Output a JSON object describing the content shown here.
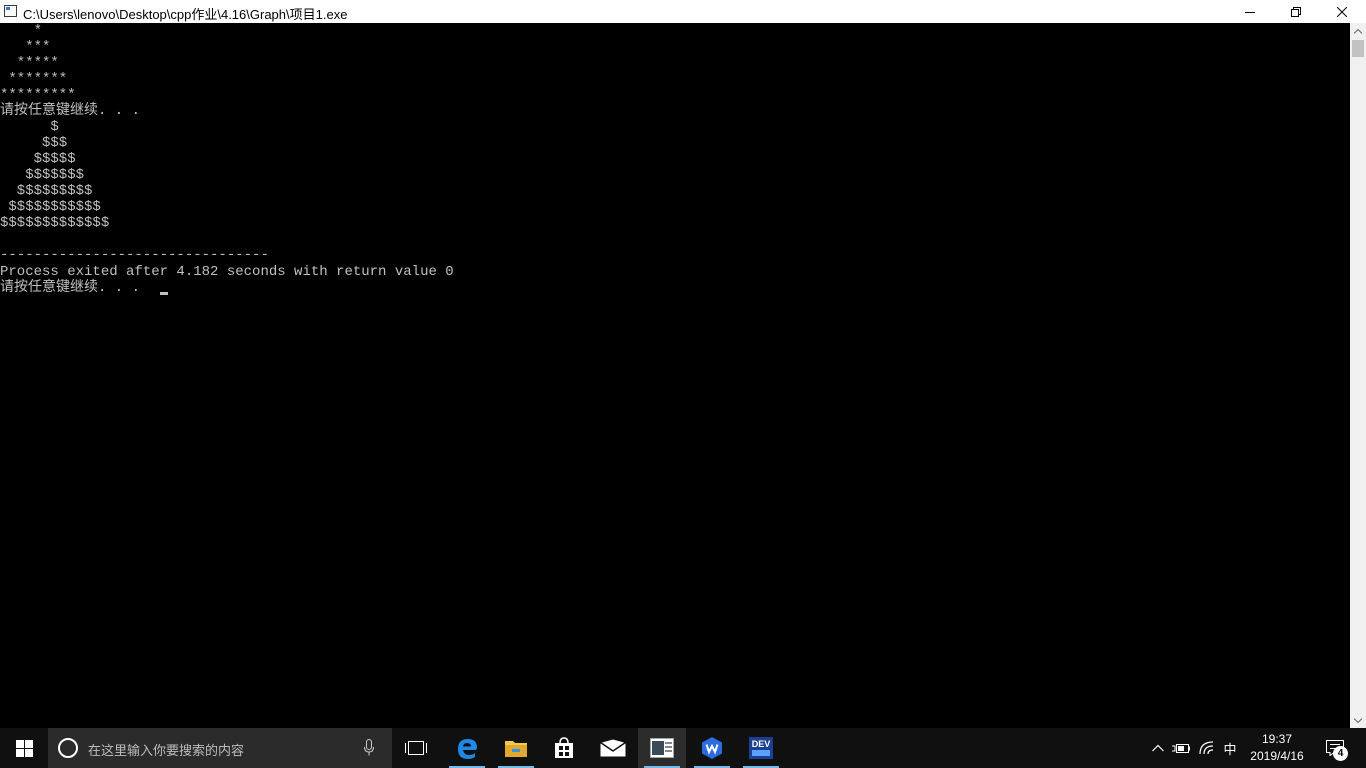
{
  "window": {
    "title": "C:\\Users\\lenovo\\Desktop\\cpp作业\\4.16\\Graph\\项目1.exe"
  },
  "console": {
    "lines": [
      "    *",
      "   ***",
      "  *****",
      " *******",
      "*********",
      "请按任意键继续. . .",
      "      $",
      "     $$$",
      "    $$$$$",
      "   $$$$$$$",
      "  $$$$$$$$$",
      " $$$$$$$$$$$",
      "$$$$$$$$$$$$$",
      "",
      "--------------------------------",
      "Process exited after 4.182 seconds with return value 0",
      "请按任意键继续. . ."
    ]
  },
  "taskbar": {
    "search_placeholder": "在这里输入你要搜索的内容",
    "dev_label": "DEV",
    "ime": "中",
    "time": "19:37",
    "date": "2019/4/16",
    "notification_count": "4"
  },
  "colors": {
    "console_bg": "#000000",
    "console_text": "#c0c0c0",
    "taskbar_bg": "#101010",
    "accent": "#76b9ed"
  }
}
